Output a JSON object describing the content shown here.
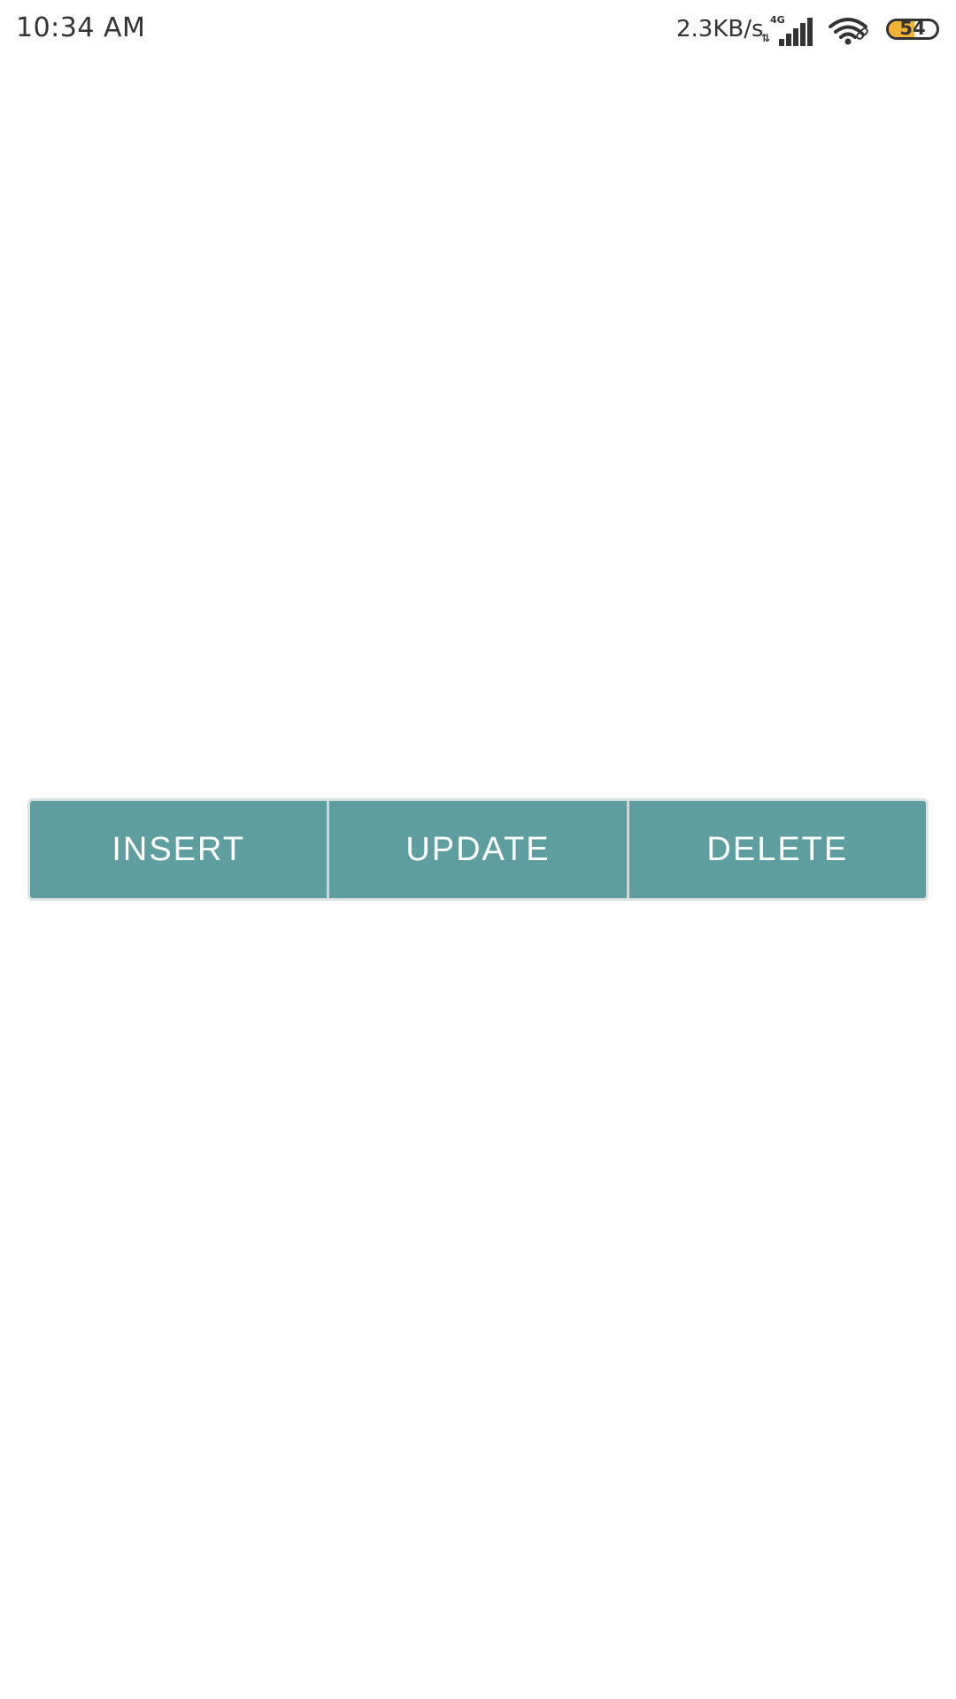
{
  "status_bar": {
    "time": "10:34 AM",
    "speed": "2.3KB/s",
    "network_type": "4G",
    "battery_level": "54",
    "battery_fraction": 0.54,
    "icons": [
      "signal-icon",
      "wifi-icon",
      "battery-icon"
    ]
  },
  "buttons": {
    "insert_label": "INSERT",
    "update_label": "UPDATE",
    "delete_label": "DELETE"
  },
  "colors": {
    "button_background": "#5f9ea0",
    "button_text": "#ffffff",
    "battery_fill": "#f5b335"
  }
}
